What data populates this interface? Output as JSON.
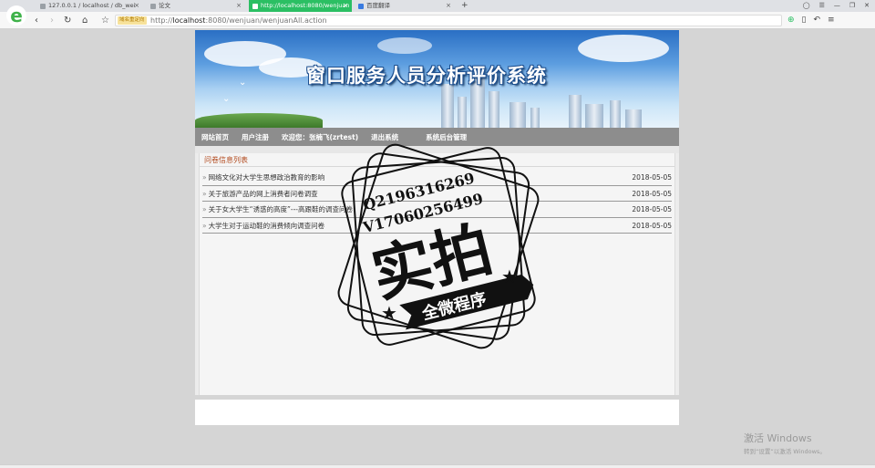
{
  "browser": {
    "tabs": [
      {
        "title": "127.0.0.1 / localhost / db_wei",
        "active": false
      },
      {
        "title": "论文",
        "active": false
      },
      {
        "title": "http://localhost:8080/wenjuan",
        "active": true
      },
      {
        "title": "百度翻译",
        "active": false
      }
    ],
    "new_tab": "+",
    "address": {
      "badge": "域名重定向",
      "prefix": "http://",
      "host": "localhost",
      "path": ":8080/wenjuan/wenjuanAll.action"
    },
    "colors": {
      "accent": "#2bbf63"
    }
  },
  "site": {
    "banner_title": "窗口服务人员分析评价系统",
    "nav": [
      {
        "label": "网站首页"
      },
      {
        "label": "用户注册"
      },
      {
        "label": "欢迎您：张楠飞(zrtest)"
      },
      {
        "label": "退出系统"
      },
      {
        "label": "系统后台管理"
      }
    ]
  },
  "survey_list": {
    "heading": "问卷信息列表",
    "bullet": "»",
    "items": [
      {
        "title": "网络文化对大学生思想政治教育的影响",
        "date": "2018-05-05"
      },
      {
        "title": "关于旅游产品的网上消费者问卷调查",
        "date": "2018-05-05"
      },
      {
        "title": "关于女大学生“诱惑的高度”---高跟鞋的调查问卷",
        "date": "2018-05-05"
      },
      {
        "title": "大学生对于运动鞋的消费倾向调查问卷",
        "date": "2018-05-05"
      }
    ]
  },
  "watermark": {
    "line1": "Q2196316269",
    "line2": "V17060256499",
    "main": "实拍",
    "ribbon": "全微程序"
  },
  "windows_activation": {
    "title": "激活 Windows",
    "subtitle": "转到“设置”以激活 Windows。"
  }
}
